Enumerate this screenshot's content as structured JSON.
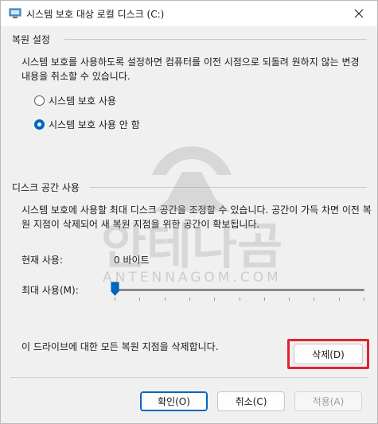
{
  "window": {
    "title": "시스템 보호 대상 로컬 디스크 (C:)"
  },
  "restore_settings": {
    "section_title": "복원 설정",
    "description": "시스템 보호를 사용하도록 설정하면 컴퓨터를 이전 시점으로 되돌려 원하지 않는 변경 내용을 취소할 수 있습니다.",
    "options": [
      {
        "label": "시스템 보호 사용",
        "checked": false
      },
      {
        "label": "시스템 보호 사용 안 함",
        "checked": true
      }
    ]
  },
  "disk_usage": {
    "section_title": "디스크 공간 사용",
    "description": "시스템 보호에 사용할 최대 디스크 공간을 조정할 수 있습니다. 공간이 가득 차면 이전 복원 지점이 삭제되어 새 복원 지점을 위한 공간이 확보됩니다.",
    "current_label": "현재 사용:",
    "current_value": "0 바이트",
    "max_label": "최대 사용(M):",
    "max_fraction": 0.0
  },
  "delete_section": {
    "description": "이 드라이브에 대한 모든 복원 지점을 삭제합니다.",
    "delete_button": "삭제(D)"
  },
  "footer": {
    "ok": "확인(O)",
    "cancel": "취소(C)",
    "apply": "적용(A)"
  },
  "watermark": {
    "brand": "안테나곰",
    "domain": "ANTENNAGOM.COM"
  },
  "colors": {
    "accent": "#0067c0",
    "highlight": "#e0232e"
  }
}
